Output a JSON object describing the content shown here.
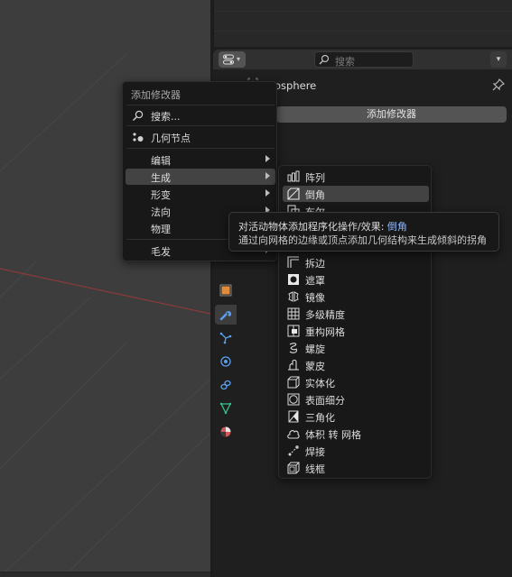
{
  "properties": {
    "search_placeholder": "搜索",
    "object_name": "osphere",
    "add_modifier_button": "添加修改器"
  },
  "add_menu": {
    "title": "添加修改器",
    "search_label": "搜索...",
    "geometry_nodes_label": "几何节点",
    "categories": [
      "编辑",
      "生成",
      "形变",
      "法向",
      "物理",
      "毛发"
    ],
    "hovered_category": "生成"
  },
  "generate_menu": {
    "items": [
      {
        "label": "阵列",
        "icon": "array-icon"
      },
      {
        "label": "倒角",
        "icon": "bevel-icon"
      },
      {
        "label": "布尔",
        "icon": "boolean-icon"
      },
      {
        "label": "拆边",
        "icon": "edge-split-icon"
      },
      {
        "label": "遮罩",
        "icon": "mask-icon"
      },
      {
        "label": "镜像",
        "icon": "mirror-icon"
      },
      {
        "label": "多级精度",
        "icon": "multires-icon"
      },
      {
        "label": "重构网格",
        "icon": "remesh-icon"
      },
      {
        "label": "螺旋",
        "icon": "screw-icon"
      },
      {
        "label": "蒙皮",
        "icon": "skin-icon"
      },
      {
        "label": "实体化",
        "icon": "solidify-icon"
      },
      {
        "label": "表面细分",
        "icon": "subsurf-icon"
      },
      {
        "label": "三角化",
        "icon": "triangulate-icon"
      },
      {
        "label": "体积 转 网格",
        "icon": "volume-to-mesh-icon"
      },
      {
        "label": "焊接",
        "icon": "weld-icon"
      },
      {
        "label": "线框",
        "icon": "wireframe-icon"
      }
    ],
    "hovered": "倒角"
  },
  "tooltip": {
    "line1_prefix": "对活动物体添加程序化操作/效果: ",
    "line1_highlight": "倒角",
    "line2": "通过向网格的边缘或顶点添加几何结构来生成倾斜的拐角"
  },
  "colors": {
    "accent_blue": "#8fb8ff",
    "menu_bg": "#181818",
    "hover_bg": "#434343",
    "active_tab": "#3d3d3d"
  }
}
